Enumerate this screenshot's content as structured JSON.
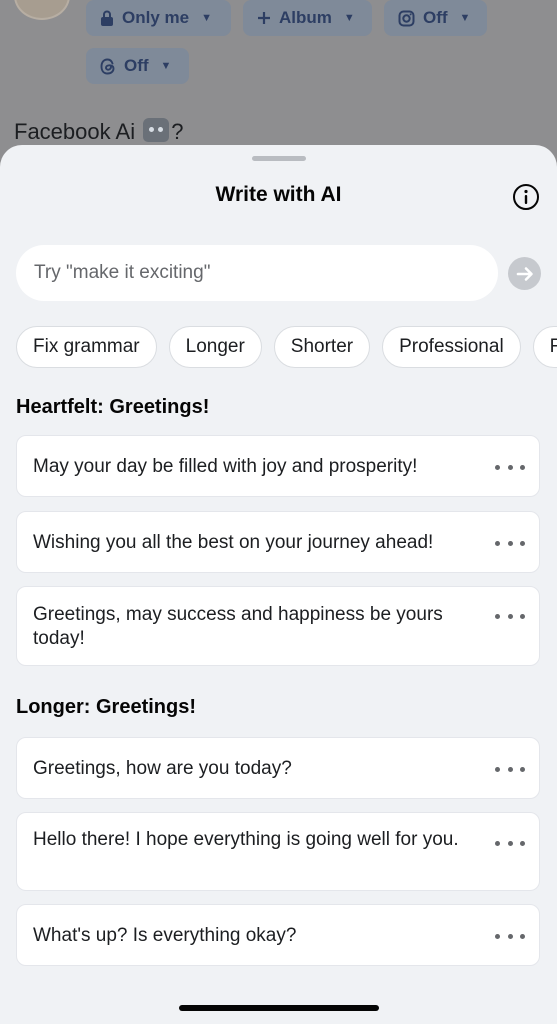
{
  "background": {
    "audience_chip": "Only me",
    "album_chip": "Album",
    "instagram_chip": "Off",
    "threads_chip": "Off",
    "post_text": "Facebook Ai",
    "post_text_suffix": "?"
  },
  "sheet": {
    "title": "Write with AI",
    "prompt": {
      "placeholder": "Try \"make it exciting\"",
      "value": ""
    },
    "quick_actions": [
      "Fix grammar",
      "Longer",
      "Shorter",
      "Professional",
      "F"
    ],
    "sections": [
      {
        "heading": "Heartfelt: Greetings!",
        "suggestions": [
          "May your day be filled with joy and prosperity!",
          "Wishing you all the best on your journey ahead!",
          "Greetings, may success and happiness be yours today!"
        ]
      },
      {
        "heading": "Longer: Greetings!",
        "suggestions": [
          "Greetings, how are you today?",
          "Hello there! I hope everything is going well for you.",
          "What's up? Is everything okay?"
        ]
      }
    ]
  },
  "colors": {
    "sheet_bg": "#f0f2f5",
    "card_bg": "#ffffff",
    "overlay_dim": "#8e8e90",
    "chip_bg": "#7f8a99",
    "chip_text": "#2d3e63"
  },
  "icons": [
    "lock-icon",
    "plus-icon",
    "instagram-icon",
    "threads-icon",
    "info-icon",
    "arrow-right-icon",
    "more-icon"
  ]
}
